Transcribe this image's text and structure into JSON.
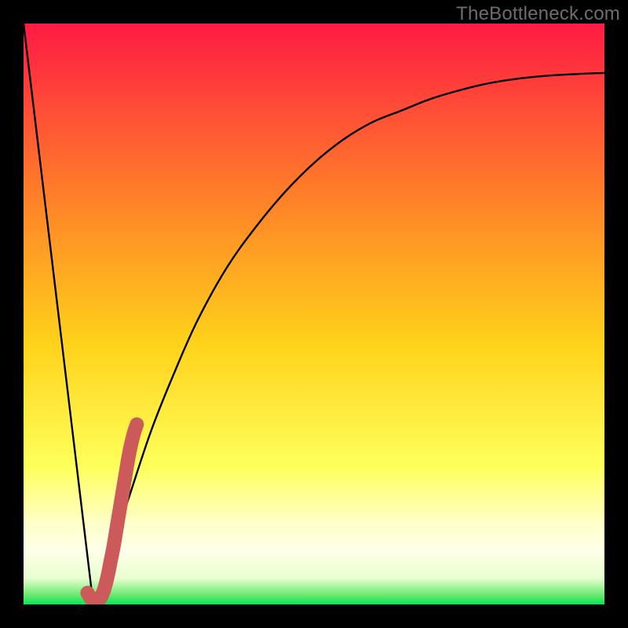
{
  "watermark": "TheBottleneck.com",
  "colors": {
    "gradient_top": "#ff1a44",
    "gradient_mid_upper": "#ff7a2a",
    "gradient_mid": "#ffd21a",
    "gradient_mid_lower": "#ffff5a",
    "gradient_band": "#ffffc8",
    "gradient_bottom": "#00e85a",
    "curve": "#000000",
    "bar": "#cc5a5a",
    "frame": "#000000"
  },
  "chart_data": {
    "type": "line",
    "title": "",
    "xlabel": "",
    "ylabel": "",
    "xlim": [
      0,
      100
    ],
    "ylim": [
      0,
      100
    ],
    "series": [
      {
        "name": "left-branch",
        "x": [
          0,
          12
        ],
        "values": [
          100,
          0
        ]
      },
      {
        "name": "right-branch",
        "x": [
          12,
          15,
          18,
          22,
          26,
          30,
          35,
          40,
          45,
          50,
          55,
          60,
          65,
          70,
          75,
          80,
          85,
          90,
          95,
          100
        ],
        "values": [
          0,
          9,
          18,
          30,
          40,
          49,
          58,
          65,
          71,
          76,
          80,
          83,
          85,
          87,
          88.5,
          89.7,
          90.5,
          91,
          91.3,
          91.5
        ]
      },
      {
        "name": "highlight-bar",
        "x": [
          11,
          11.5,
          12,
          12.5,
          13,
          13.5,
          14,
          14.5,
          15,
          15.5,
          16,
          16.5,
          17,
          17.5,
          18,
          18.5,
          19,
          19.5
        ],
        "values": [
          2,
          1.2,
          0.6,
          0.5,
          0.8,
          1.6,
          3,
          5,
          7.5,
          10,
          13,
          16,
          19,
          22,
          25,
          27.5,
          29.5,
          31
        ]
      }
    ],
    "annotations": []
  }
}
